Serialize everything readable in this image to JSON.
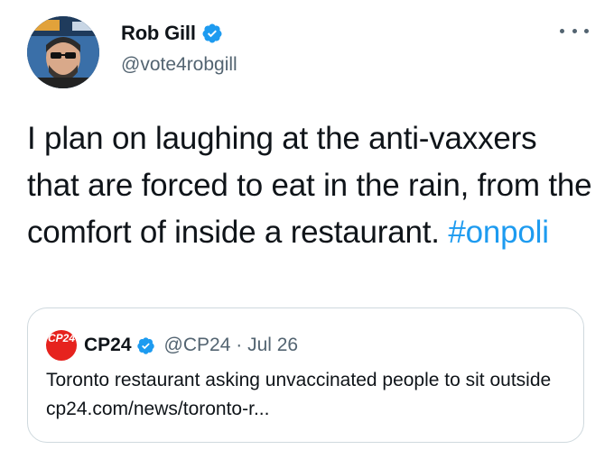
{
  "author": {
    "display_name": "Rob Gill",
    "handle": "@vote4robgill",
    "verified": true,
    "avatar_icon": "profile-photo-avatar"
  },
  "more_icon": "ellipsis-icon",
  "tweet": {
    "text": "I plan on laughing at the anti-vaxxers that are forced to eat in the rain, from the comfort of inside a restaurant.",
    "hashtag": "#onpoli"
  },
  "quoted": {
    "logo_text": "CP24",
    "display_name": "CP24",
    "handle": "@CP24",
    "separator": "·",
    "date": "Jul 26",
    "text": "Toronto restaurant asking unvaccinated people to sit outside cp24.com/news/toronto-r..."
  },
  "colors": {
    "link": "#1d9bf0",
    "secondary_text": "#536471",
    "border": "#cfd9de",
    "cp24_red": "#e6231e"
  }
}
